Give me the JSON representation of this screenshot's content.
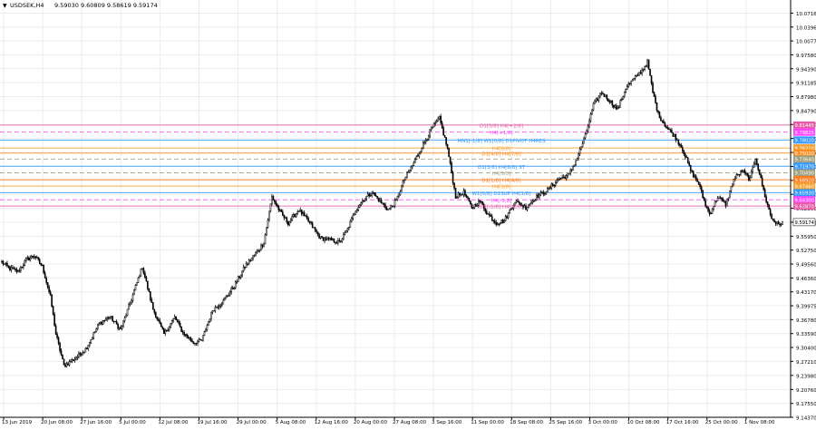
{
  "header": {
    "symbol_label": "USDSEK,H4",
    "ohlc_text": "9.59030 9.60809 9.58619 9.59174",
    "arrow_glyph": "▼"
  },
  "chart_data": {
    "type": "candlestick",
    "symbol": "USDSEK",
    "timeframe": "H4",
    "ylim": [
      9.1437,
      10.1017
    ],
    "y_ticks": [
      10.0716,
      10.0396,
      10.0077,
      9.9758,
      9.9439,
      9.9118,
      9.8798,
      9.8479,
      9.8159,
      9.7838,
      9.7517,
      9.7196,
      9.6876,
      9.6556,
      9.6236,
      9.5915,
      9.5595,
      9.5275,
      9.4956,
      9.4636,
      9.4317,
      9.3998,
      9.3679,
      9.3359,
      9.304,
      9.2721,
      9.2398,
      9.2076,
      9.1755,
      9.1437
    ],
    "y_tick_labels": [
      "10.07160",
      "10.03965",
      "10.00770",
      "9.97580",
      "9.94390",
      "9.91185",
      "9.87980",
      "9.84790",
      "9.81590",
      "9.78380",
      "9.75165",
      "9.71960",
      "9.68760",
      "9.65560",
      "9.62360",
      "9.59150",
      "9.55950",
      "9.52750",
      "9.49560",
      "9.46360",
      "9.43170",
      "9.39975",
      "9.36780",
      "9.33590",
      "9.30400",
      "9.27210",
      "9.23980",
      "9.20760",
      "9.17550",
      "9.14370"
    ],
    "x_labels": [
      "13 Jun 2019",
      "20 Jun 08:00",
      "27 Jun 16:00",
      "5 Jul 00:00",
      "12 Jul 08:00",
      "19 Jul 16:00",
      "29 Jul 00:00",
      "5 Aug 08:00",
      "12 Aug 16:00",
      "20 Aug 00:00",
      "27 Aug 08:00",
      "3 Sep 16:00",
      "11 Sep 00:00",
      "18 Sep 08:00",
      "25 Sep 16:00",
      "3 Oct 00:00",
      "10 Oct 08:00",
      "17 Oct 16:00",
      "25 Oct 00:00",
      "1 Nov 08:00"
    ],
    "anchors": [
      [
        0,
        9.5
      ],
      [
        6,
        9.485
      ],
      [
        12,
        9.478
      ],
      [
        18,
        9.505
      ],
      [
        24,
        9.515
      ],
      [
        30,
        9.49
      ],
      [
        36,
        9.42
      ],
      [
        40,
        9.335
      ],
      [
        46,
        9.262
      ],
      [
        54,
        9.278
      ],
      [
        62,
        9.3
      ],
      [
        72,
        9.358
      ],
      [
        80,
        9.375
      ],
      [
        88,
        9.345
      ],
      [
        96,
        9.415
      ],
      [
        104,
        9.49
      ],
      [
        112,
        9.392
      ],
      [
        120,
        9.335
      ],
      [
        128,
        9.373
      ],
      [
        134,
        9.338
      ],
      [
        142,
        9.315
      ],
      [
        148,
        9.32
      ],
      [
        156,
        9.39
      ],
      [
        164,
        9.41
      ],
      [
        172,
        9.445
      ],
      [
        180,
        9.49
      ],
      [
        188,
        9.52
      ],
      [
        194,
        9.545
      ],
      [
        200,
        9.65
      ],
      [
        206,
        9.615
      ],
      [
        212,
        9.59
      ],
      [
        220,
        9.62
      ],
      [
        228,
        9.59
      ],
      [
        236,
        9.555
      ],
      [
        244,
        9.55
      ],
      [
        250,
        9.545
      ],
      [
        256,
        9.575
      ],
      [
        262,
        9.62
      ],
      [
        268,
        9.645
      ],
      [
        274,
        9.66
      ],
      [
        280,
        9.64
      ],
      [
        286,
        9.62
      ],
      [
        292,
        9.64
      ],
      [
        298,
        9.69
      ],
      [
        304,
        9.722
      ],
      [
        312,
        9.77
      ],
      [
        318,
        9.805
      ],
      [
        324,
        9.83
      ],
      [
        330,
        9.76
      ],
      [
        336,
        9.65
      ],
      [
        342,
        9.66
      ],
      [
        348,
        9.625
      ],
      [
        354,
        9.64
      ],
      [
        360,
        9.61
      ],
      [
        366,
        9.59
      ],
      [
        372,
        9.595
      ],
      [
        380,
        9.64
      ],
      [
        388,
        9.625
      ],
      [
        396,
        9.65
      ],
      [
        404,
        9.665
      ],
      [
        412,
        9.69
      ],
      [
        420,
        9.7
      ],
      [
        426,
        9.74
      ],
      [
        432,
        9.79
      ],
      [
        438,
        9.86
      ],
      [
        444,
        9.89
      ],
      [
        450,
        9.87
      ],
      [
        456,
        9.85
      ],
      [
        462,
        9.9
      ],
      [
        468,
        9.92
      ],
      [
        474,
        9.94
      ],
      [
        478,
        9.96
      ],
      [
        482,
        9.89
      ],
      [
        486,
        9.84
      ],
      [
        492,
        9.81
      ],
      [
        498,
        9.79
      ],
      [
        504,
        9.76
      ],
      [
        510,
        9.71
      ],
      [
        516,
        9.68
      ],
      [
        520,
        9.64
      ],
      [
        524,
        9.61
      ],
      [
        530,
        9.65
      ],
      [
        536,
        9.632
      ],
      [
        542,
        9.69
      ],
      [
        548,
        9.71
      ],
      [
        554,
        9.69
      ],
      [
        558,
        9.74
      ],
      [
        562,
        9.69
      ],
      [
        566,
        9.64
      ],
      [
        570,
        9.6
      ],
      [
        575,
        9.585
      ],
      [
        578,
        9.592
      ]
    ],
    "levels": [
      {
        "label": "D1[5/8] H4[+2/8]",
        "value": 9.8145,
        "color": "#e85aa8",
        "dash": "solid",
        "tag": "9.81445"
      },
      {
        "label": "H4[+1/8]",
        "value": 9.7983,
        "color": "#ff44ff",
        "dash": "dashed",
        "tag": "9.79825"
      },
      {
        "label": "MN1[-1/8] W1[0/8] D1PIVOT H4RES",
        "value": 9.7802,
        "color": "#3399ff",
        "dash": "solid",
        "tag": "9.78020"
      },
      {
        "label": "H4[8/8]",
        "value": 9.7621,
        "color": "#f5a030",
        "dash": "solid",
        "tag": "9.76210"
      },
      {
        "label": "D1[4/8] H4[7/8]",
        "value": 9.7502,
        "color": "#ff8c1a",
        "dash": "solid",
        "tag": "9.75020"
      },
      {
        "label": "",
        "value": 9.7364,
        "color": "#a0a080",
        "dash": "dashed",
        "tag": "9.73640"
      },
      {
        "label": "D1[3/8] H4[6/8] ST",
        "value": 9.72,
        "color": "#3399ff",
        "dash": "solid",
        "tag": "9.71970"
      },
      {
        "label": "H4[5/8]",
        "value": 9.7049,
        "color": "#a0a080",
        "dash": "dashed",
        "tag": "9.70490"
      },
      {
        "label": "D1[1/8] H4[4/8]",
        "value": 9.6892,
        "color": "#ff7a1a",
        "dash": "solid",
        "tag": "9.68920"
      },
      {
        "label": "H4[3/8]",
        "value": 9.6746,
        "color": "#f5a030",
        "dash": "solid",
        "tag": "9.67460"
      },
      {
        "label": "W1[0/8] D1SUP H4[1/8]",
        "value": 9.6593,
        "color": "#3399ff",
        "dash": "solid",
        "tag": "9.65930"
      },
      {
        "label": "H4[-1/8]",
        "value": 9.643,
        "color": "#ff44ff",
        "dash": "dashed",
        "tag": "9.64300"
      },
      {
        "label": "D1[-1/8] H4[-2/8]",
        "value": 9.6287,
        "color": "#e85aa8",
        "dash": "solid",
        "tag": "9.62870"
      }
    ],
    "price_tag": {
      "value": 9.5917,
      "tag": "9.59174",
      "color": "#ffffff"
    },
    "grid": true,
    "background": "#ffffff",
    "candle_color": "#000000"
  }
}
